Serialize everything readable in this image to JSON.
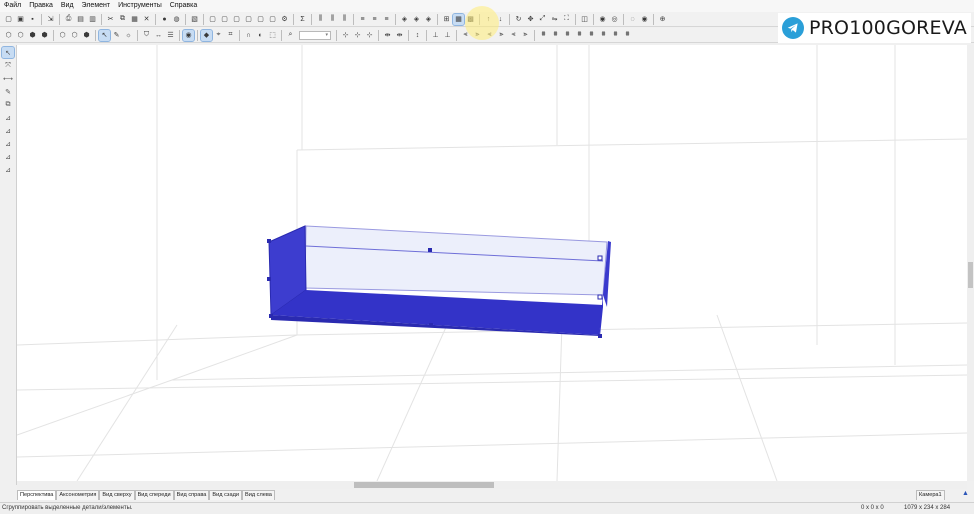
{
  "menu": [
    "Файл",
    "Правка",
    "Вид",
    "Элемент",
    "Инструменты",
    "Справка"
  ],
  "toolbar1": [
    {
      "name": "new-file-icon",
      "glyph": "▢"
    },
    {
      "name": "open-file-icon",
      "glyph": "▣"
    },
    {
      "name": "save-icon",
      "glyph": "▪"
    },
    {
      "sep": true
    },
    {
      "name": "export-icon",
      "glyph": "⇲"
    },
    {
      "sep": true
    },
    {
      "name": "print-icon",
      "glyph": "⎙"
    },
    {
      "name": "preview-icon",
      "glyph": "▤"
    },
    {
      "name": "page-setup-icon",
      "glyph": "▥"
    },
    {
      "sep": true
    },
    {
      "name": "cut-icon",
      "glyph": "✂"
    },
    {
      "name": "copy-icon",
      "glyph": "⧉"
    },
    {
      "name": "paste-icon",
      "glyph": "▦"
    },
    {
      "name": "delete-icon",
      "glyph": "✕"
    },
    {
      "sep": true
    },
    {
      "name": "materials-icon",
      "glyph": "●"
    },
    {
      "name": "texture-icon",
      "glyph": "◍"
    },
    {
      "sep": true
    },
    {
      "name": "render-icon",
      "glyph": "▧"
    },
    {
      "sep": true
    },
    {
      "name": "view-icon-1",
      "glyph": "▢"
    },
    {
      "name": "view-icon-2",
      "glyph": "▢"
    },
    {
      "name": "view-icon-3",
      "glyph": "▢"
    },
    {
      "name": "view-icon-4",
      "glyph": "▢"
    },
    {
      "name": "view-icon-5",
      "glyph": "▢"
    },
    {
      "name": "view-icon-6",
      "glyph": "▢"
    },
    {
      "name": "settings-icon",
      "glyph": "⚙"
    },
    {
      "sep": true
    },
    {
      "name": "sum-icon",
      "glyph": "Σ"
    },
    {
      "sep": true
    },
    {
      "name": "align-icon-1",
      "glyph": "⫼"
    },
    {
      "name": "align-icon-2",
      "glyph": "⫼"
    },
    {
      "name": "align-icon-3",
      "glyph": "⫼"
    },
    {
      "sep": true
    },
    {
      "name": "distribute-icon-1",
      "glyph": "≡"
    },
    {
      "name": "distribute-icon-2",
      "glyph": "≡"
    },
    {
      "name": "distribute-icon-3",
      "glyph": "≡"
    },
    {
      "sep": true
    },
    {
      "name": "order-icon-1",
      "glyph": "◈"
    },
    {
      "name": "order-icon-2",
      "glyph": "◈"
    },
    {
      "name": "order-icon-3",
      "glyph": "◈"
    },
    {
      "sep": true
    },
    {
      "name": "grid-icon",
      "glyph": "⊞"
    },
    {
      "name": "group-icon",
      "glyph": "▦",
      "sel": true
    },
    {
      "name": "ungroup-icon",
      "glyph": "▩"
    },
    {
      "sep": true
    },
    {
      "name": "move-up-icon",
      "glyph": "↑"
    },
    {
      "name": "move-down-icon",
      "glyph": "↓"
    },
    {
      "sep": true
    },
    {
      "name": "rotate-icon",
      "glyph": "↻"
    },
    {
      "name": "move-icon",
      "glyph": "✥"
    },
    {
      "name": "scale-icon",
      "glyph": "⤢"
    },
    {
      "name": "mirror-icon",
      "glyph": "⇋"
    },
    {
      "name": "fit-icon",
      "glyph": "⛶"
    },
    {
      "sep": true
    },
    {
      "name": "contour-icon",
      "glyph": "◫"
    },
    {
      "sep": true
    },
    {
      "name": "hide-icon",
      "glyph": "◉"
    },
    {
      "name": "show-icon",
      "glyph": "◎"
    },
    {
      "sep": true
    },
    {
      "name": "eye-icon",
      "glyph": "◌"
    },
    {
      "name": "eye-visible-icon",
      "glyph": "◉"
    },
    {
      "sep": true
    },
    {
      "name": "target-icon",
      "glyph": "⊕"
    }
  ],
  "toolbar2": [
    {
      "name": "shape-icon-1",
      "glyph": "⬡"
    },
    {
      "name": "shape-icon-2",
      "glyph": "⬡"
    },
    {
      "name": "shape-icon-3",
      "glyph": "⬢"
    },
    {
      "name": "shape-icon-4",
      "glyph": "⬢"
    },
    {
      "sep": true
    },
    {
      "name": "shape-icon-5",
      "glyph": "⬡"
    },
    {
      "name": "shape-icon-6",
      "glyph": "⬡"
    },
    {
      "name": "shape-icon-7",
      "glyph": "⬢"
    },
    {
      "sep": true
    },
    {
      "name": "select-mode-icon",
      "glyph": "↖",
      "sel": true
    },
    {
      "name": "material-pick-icon",
      "glyph": "✎"
    },
    {
      "name": "light-icon",
      "glyph": "☼"
    },
    {
      "sep": true
    },
    {
      "name": "edge-icon",
      "glyph": "⛉"
    },
    {
      "name": "dimension-icon",
      "glyph": "↔"
    },
    {
      "name": "list-icon",
      "glyph": "☰"
    },
    {
      "sep": true
    },
    {
      "name": "view-eye-icon",
      "glyph": "◉",
      "sel": true
    },
    {
      "sep": true
    },
    {
      "name": "snap-icon",
      "glyph": "◆",
      "sel": true
    },
    {
      "name": "snap-point-icon",
      "glyph": "⌖"
    },
    {
      "name": "snap-edge-icon",
      "glyph": "⌗"
    },
    {
      "sep": true
    },
    {
      "name": "magnet-icon",
      "glyph": "∩"
    },
    {
      "name": "face-icon",
      "glyph": "◐"
    },
    {
      "name": "wire-icon",
      "glyph": "⬚"
    },
    {
      "sep": true
    },
    {
      "name": "zoom-icon",
      "glyph": "⌕"
    },
    {
      "zoom": true
    },
    {
      "sep": true
    },
    {
      "name": "ruler-icon-1",
      "glyph": "⊹"
    },
    {
      "name": "ruler-icon-2",
      "glyph": "⊹"
    },
    {
      "name": "ruler-icon-3",
      "glyph": "⊹"
    },
    {
      "sep": true
    },
    {
      "name": "measure-icon-1",
      "glyph": "⇹"
    },
    {
      "name": "measure-icon-2",
      "glyph": "⇹"
    },
    {
      "sep": true
    },
    {
      "name": "vertical-measure-icon",
      "glyph": "↕"
    },
    {
      "sep": true
    },
    {
      "name": "level-icon-1",
      "glyph": "⊥"
    },
    {
      "name": "level-icon-2",
      "glyph": "⊥"
    },
    {
      "sep": true
    },
    {
      "name": "arrange-icon-1",
      "glyph": "⫷"
    },
    {
      "name": "arrange-icon-2",
      "glyph": "⫸"
    },
    {
      "name": "arrange-icon-3",
      "glyph": "⫷"
    },
    {
      "name": "arrange-icon-4",
      "glyph": "⫸"
    },
    {
      "name": "arrange-icon-5",
      "glyph": "⫷"
    },
    {
      "name": "arrange-icon-6",
      "glyph": "⫸"
    },
    {
      "sep": true
    },
    {
      "name": "stack-icon-1",
      "glyph": "⩩"
    },
    {
      "name": "stack-icon-2",
      "glyph": "⩩"
    },
    {
      "name": "stack-icon-3",
      "glyph": "⩩"
    },
    {
      "name": "stack-icon-4",
      "glyph": "⩩"
    },
    {
      "name": "stack-icon-5",
      "glyph": "⩩"
    },
    {
      "name": "stack-icon-6",
      "glyph": "⩩"
    },
    {
      "name": "stack-icon-7",
      "glyph": "⩩"
    },
    {
      "name": "stack-icon-8",
      "glyph": "⩩"
    }
  ],
  "left_tools": [
    {
      "name": "pointer-tool-icon",
      "glyph": "↖",
      "sel": true
    },
    {
      "name": "transform-tool-icon",
      "glyph": "⤧"
    },
    {
      "name": "dimension-tool-icon",
      "glyph": "⟷"
    },
    {
      "name": "pick-tool-icon",
      "glyph": "✎"
    },
    {
      "name": "copy-tool-icon",
      "glyph": "⧉"
    },
    {
      "name": "edit-tool-icon-1",
      "glyph": "⊿"
    },
    {
      "name": "edit-tool-icon-2",
      "glyph": "⊿"
    },
    {
      "name": "edit-tool-icon-3",
      "glyph": "⊿"
    },
    {
      "name": "edit-tool-icon-4",
      "glyph": "⊿"
    },
    {
      "name": "edit-tool-icon-5",
      "glyph": "⊿"
    }
  ],
  "brand": {
    "text": "PRO100GOREVA"
  },
  "tabs": [
    "Перспектива",
    "Аксонометрия",
    "Вид сверху",
    "Вид спереди",
    "Вид справа",
    "Вид сзади",
    "Вид слева"
  ],
  "camera": "Камера1",
  "status": {
    "text": "Сгруппировать выделенные детали/элементы.",
    "coord": "0 x 0 x 0",
    "dims": "1079 x 234 x 284"
  },
  "colors": {
    "panel": "#3a3ad0",
    "panel_dark": "#2c2cb8",
    "glass": "#e8ecfb",
    "grid": "#e2e2e2",
    "brand_icon": "#2a9fd8"
  }
}
